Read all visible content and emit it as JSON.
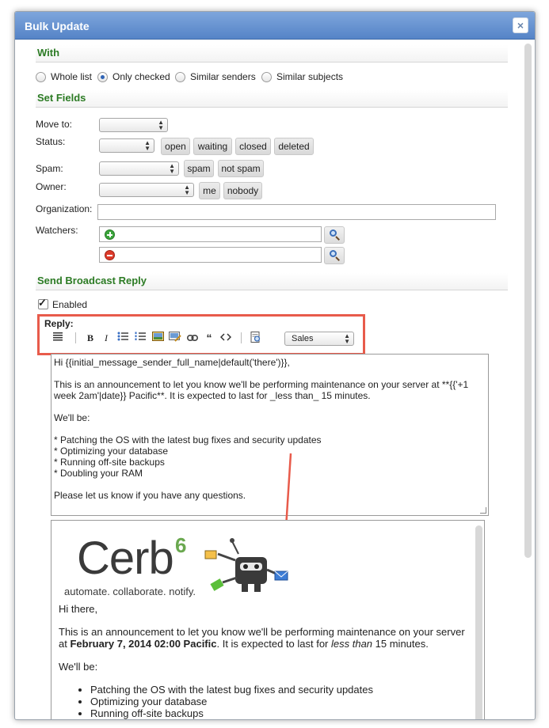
{
  "dialog": {
    "title": "Bulk Update",
    "close_icon": "×"
  },
  "with": {
    "heading": "With",
    "options": [
      {
        "label": "Whole list",
        "checked": false
      },
      {
        "label": "Only checked",
        "checked": true
      },
      {
        "label": "Similar senders",
        "checked": false
      },
      {
        "label": "Similar subjects",
        "checked": false
      }
    ]
  },
  "set_fields": {
    "heading": "Set Fields",
    "move_to": {
      "label": "Move to:",
      "value": ""
    },
    "status": {
      "label": "Status:",
      "value": "",
      "buttons": [
        "open",
        "waiting",
        "closed",
        "deleted"
      ]
    },
    "spam": {
      "label": "Spam:",
      "value": "",
      "buttons": [
        "spam",
        "not spam"
      ]
    },
    "owner": {
      "label": "Owner:",
      "value": "",
      "buttons": [
        "me",
        "nobody"
      ]
    },
    "organization": {
      "label": "Organization:",
      "value": ""
    },
    "watchers": {
      "label": "Watchers:",
      "add_value": "",
      "remove_value": ""
    }
  },
  "broadcast": {
    "heading": "Send Broadcast Reply",
    "enabled_label": "Enabled",
    "enabled": true,
    "reply_label": "Reply:",
    "template_select": "Sales",
    "toolbar_icons": [
      "paragraph-icon",
      "bold-icon",
      "italic-icon",
      "bullet-list-icon",
      "numbered-list-icon",
      "image-icon",
      "image-link-icon",
      "link-icon",
      "quote-icon",
      "code-icon",
      "preview-icon"
    ],
    "editor_lines": {
      "l1": "Hi {{initial_message_sender_full_name|default('there')}},",
      "l2": "This is an announcement to let you know we'll be performing maintenance on your server at **{{'+1",
      "l3": "week 2am'|date}} Pacific**.  It is expected to last for _less than_ 15 minutes.",
      "l4": "We'll be:",
      "l5": "* Patching the OS with the latest bug fixes and security updates",
      "l6": "* Optimizing your database",
      "l7": "* Running off-site backups",
      "l8": "* Doubling your RAM",
      "l9": "Please let us know if you have any questions."
    },
    "preview": {
      "logo_text": "Cerb",
      "logo_sup": "6",
      "tagline": "automate. collaborate. notify.",
      "greeting": "Hi there,",
      "p1_start": "This is an announcement to let you know we'll be performing maintenance on your server",
      "p1_at": "at ",
      "p1_bold": "February 7, 2014 02:00 Pacific",
      "p1_mid": ". It is expected to last for ",
      "p1_em": "less than",
      "p1_end": " 15 minutes.",
      "wellbe": "We'll be:",
      "items": [
        "Patching the OS with the latest bug fixes and security updates",
        "Optimizing your database",
        "Running off-site backups"
      ]
    }
  },
  "colors": {
    "title_bar": "#5a88c9",
    "section_heading": "#2c7b24",
    "highlight": "#e85b4b"
  }
}
